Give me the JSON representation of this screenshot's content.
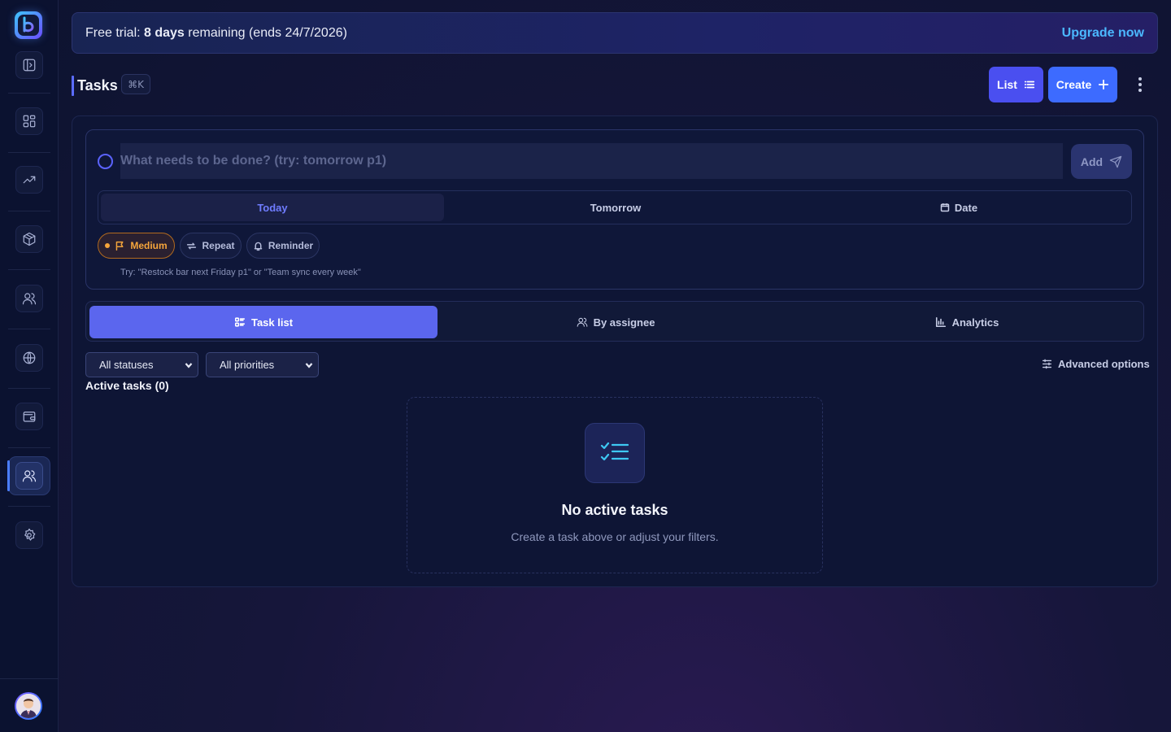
{
  "sidebar": {
    "logo_letter": "b",
    "items": [
      {
        "icon": "sidebar-toggle-icon"
      },
      {
        "icon": "dashboard-icon"
      },
      {
        "icon": "trending-up-icon"
      },
      {
        "icon": "box-icon"
      },
      {
        "icon": "users-icon"
      },
      {
        "icon": "globe-icon"
      },
      {
        "icon": "wallet-icon"
      },
      {
        "icon": "team-icon",
        "active": true
      },
      {
        "icon": "settings-icon"
      }
    ]
  },
  "banner": {
    "prefix": "Free trial: ",
    "days": "8 days",
    "suffix": " remaining (ends 24/7/2026)",
    "upgrade_label": "Upgrade now"
  },
  "header": {
    "title": "Tasks",
    "shortcut": "⌘K",
    "list_label": "List",
    "create_label": "Create"
  },
  "composer": {
    "placeholder": "What needs to be done? (try: tomorrow p1)",
    "add_label": "Add",
    "day_tabs": [
      "Today",
      "Tomorrow",
      "Date"
    ],
    "active_day": "Today",
    "chips": {
      "priority": "Medium",
      "repeat": "Repeat",
      "reminder": "Reminder"
    },
    "hint": "Try: \"Restock bar next Friday p1\" or \"Team sync every week\""
  },
  "views": {
    "tabs": [
      "Task list",
      "By assignee",
      "Analytics"
    ],
    "active": "Task list"
  },
  "filters": {
    "status": "All statuses",
    "priority": "All priorities",
    "advanced_label": "Advanced options"
  },
  "tasks": {
    "heading": "Active tasks (0)",
    "empty_title": "No active tasks",
    "empty_subtitle": "Create a task above or adjust your filters."
  },
  "colors": {
    "accent": "#5b66ee",
    "primary": "#3d6bff",
    "warning": "#f5a53b",
    "link": "#4bb8ff"
  }
}
